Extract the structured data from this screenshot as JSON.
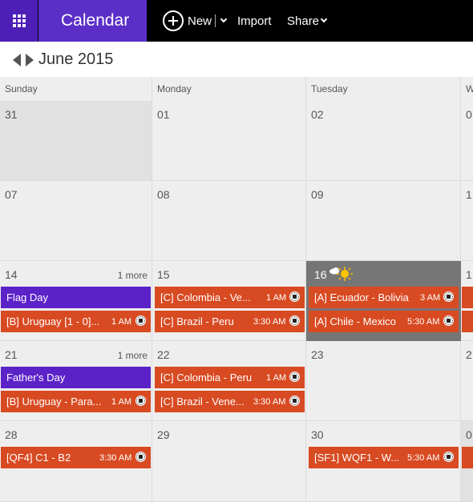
{
  "app": {
    "name": "Calendar"
  },
  "toolbar": {
    "new_label": "New",
    "import_label": "Import",
    "share_label": "Share"
  },
  "nav": {
    "month_title": "June 2015"
  },
  "weekdays": [
    "Sunday",
    "Monday",
    "Tuesday",
    "W"
  ],
  "weeks": [
    {
      "days": [
        "31",
        "01",
        "02",
        "0"
      ]
    },
    {
      "days": [
        "07",
        "08",
        "09",
        "1"
      ]
    },
    {
      "days": [
        "14",
        "15",
        "16",
        "1"
      ],
      "more": "1 more"
    },
    {
      "days": [
        "21",
        "22",
        "23",
        "2"
      ],
      "more": "1 more"
    },
    {
      "days": [
        "28",
        "29",
        "30",
        "0"
      ]
    }
  ],
  "events": {
    "w3_sun_1": {
      "title": "Flag Day"
    },
    "w3_sun_2": {
      "title": "[B] Uruguay [1 - 0]...",
      "time": "1 AM"
    },
    "w3_mon_1": {
      "title": "[C] Colombia - Ve...",
      "time": "1 AM"
    },
    "w3_mon_2": {
      "title": "[C] Brazil - Peru",
      "time": "3:30 AM"
    },
    "w3_tue_1": {
      "title": "[A] Ecuador - Bolivia",
      "time": "3 AM"
    },
    "w3_tue_2": {
      "title": "[A] Chile - Mexico",
      "time": "5:30 AM"
    },
    "w4_sun_1": {
      "title": "Father's Day"
    },
    "w4_sun_2": {
      "title": "[B] Uruguay - Para...",
      "time": "1 AM"
    },
    "w4_mon_1": {
      "title": "[C] Colombia - Peru",
      "time": "1 AM"
    },
    "w4_mon_2": {
      "title": "[C] Brazil - Vene...",
      "time": "3:30 AM"
    },
    "w5_sun_1": {
      "title": "[QF4] C1 - B2",
      "time": "3:30 AM"
    },
    "w5_tue_1": {
      "title": "[SF1] WQF1 - W...",
      "time": "5:30 AM"
    }
  },
  "colors": {
    "brand_purple": "#5b2ec8",
    "event_purple": "#5b22c8",
    "event_orange": "#d84a21",
    "today_gray": "#767676"
  },
  "icons": {
    "launcher": "waffle-grid-icon",
    "new": "plus-circle-icon",
    "prev": "triangle-left-icon",
    "next": "triangle-right-icon",
    "weather": "sun-cloud-icon",
    "soccer": "soccer-ball-icon"
  }
}
